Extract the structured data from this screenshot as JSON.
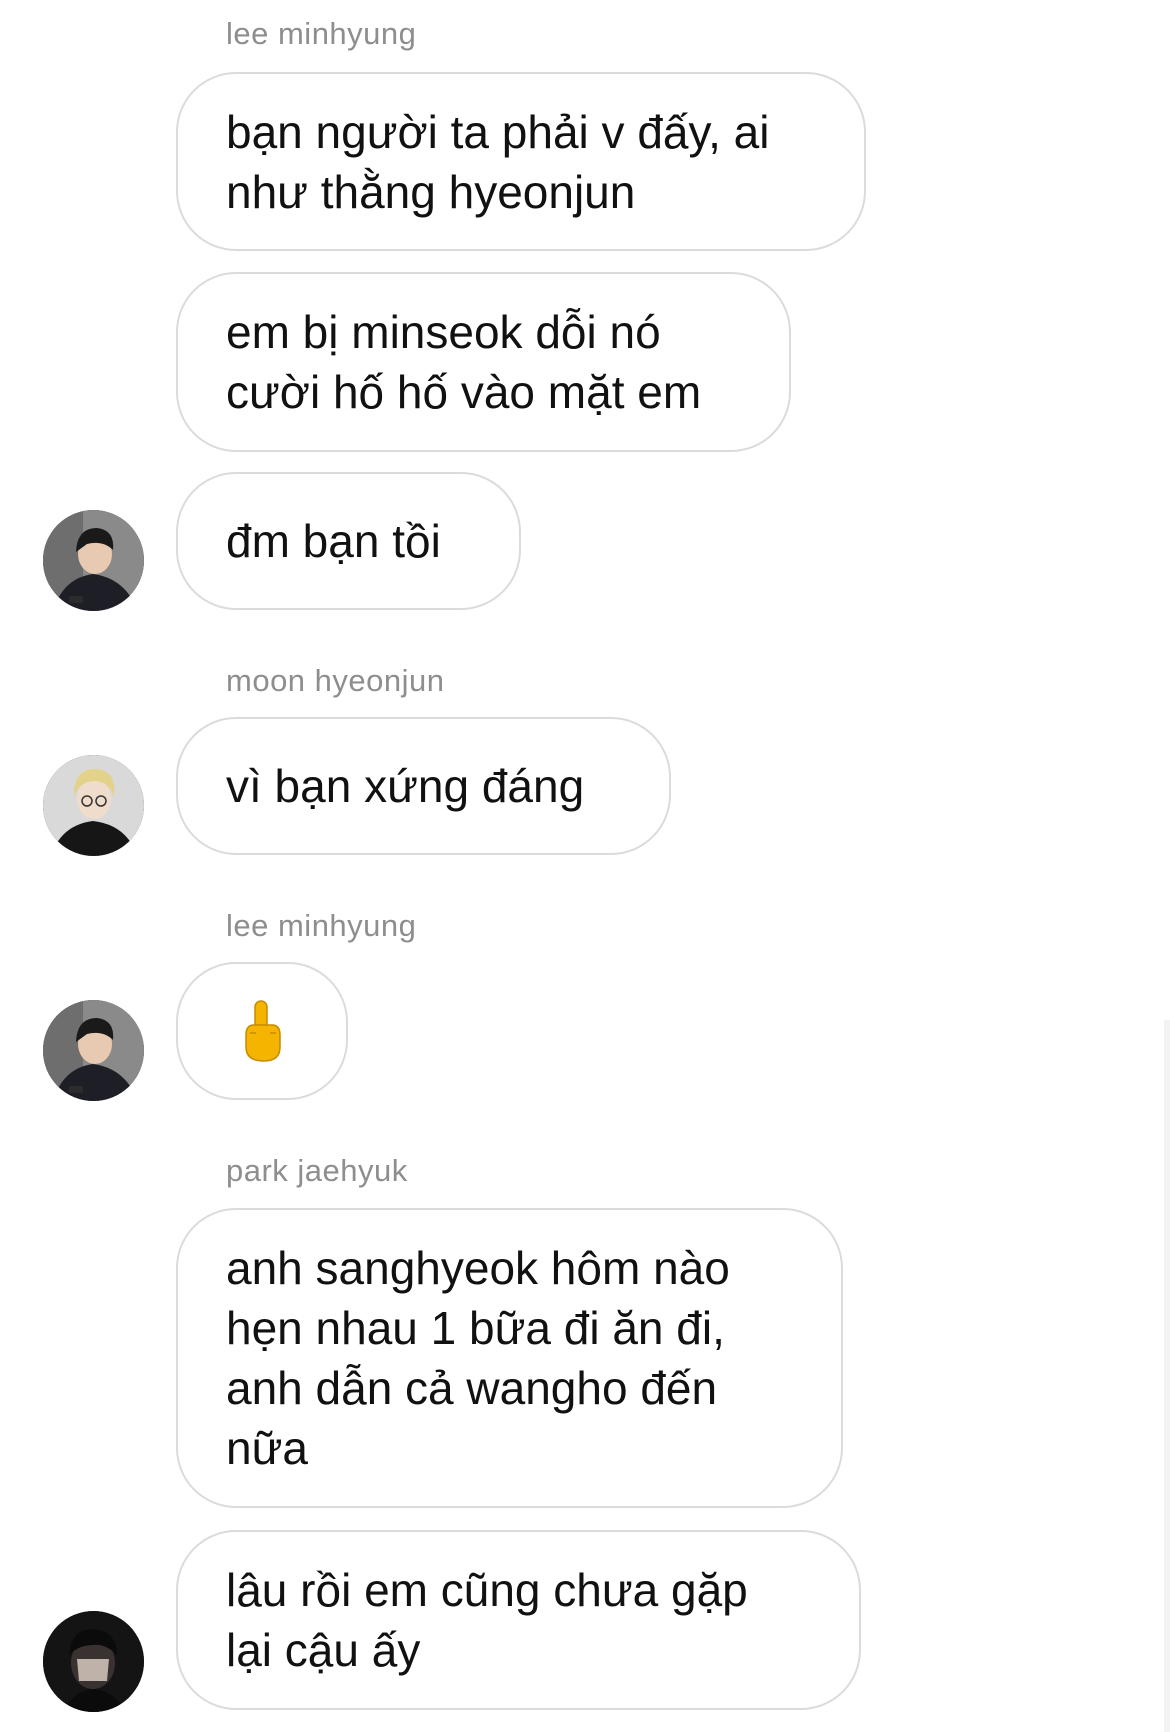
{
  "messages": [
    {
      "sender": "lee minhyung",
      "lines": [
        "bạn người ta phải v đấy, ai",
        "như thằng hyeonjun"
      ]
    },
    {
      "lines": [
        "em bị minseok dỗi nó",
        "cười hố hố vào mặt em"
      ]
    },
    {
      "lines": [
        "đm bạn tồi"
      ]
    },
    {
      "sender": "moon hyeonjun",
      "lines": [
        "vì bạn xứng đáng"
      ]
    },
    {
      "sender": "lee minhyung",
      "emoji": "middle-finger-icon"
    },
    {
      "sender": "park jaehyuk",
      "lines": [
        "anh sanghyeok hôm nào",
        "hẹn nhau 1 bữa đi ăn đi,",
        "anh dẫn cả wangho đến",
        "nữa"
      ]
    },
    {
      "lines": [
        "lâu rồi em cũng chưa gặp",
        "lại cậu ấy"
      ]
    }
  ],
  "colors": {
    "bubble_border": "#dbdbdb",
    "sender_text": "#8e8e8e",
    "message_text": "#111111",
    "background": "#ffffff"
  }
}
